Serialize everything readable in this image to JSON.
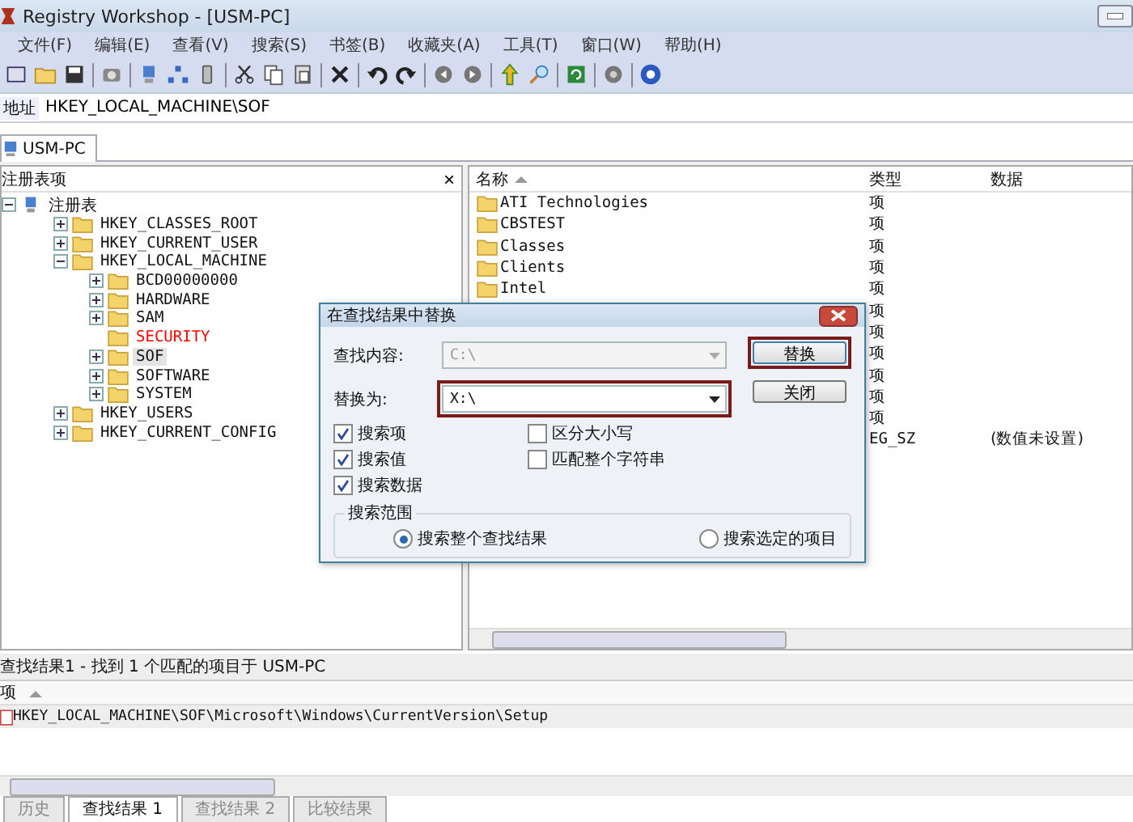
{
  "window": {
    "title": "Registry Workshop - [USM-PC]"
  },
  "menu": [
    "文件(F)",
    "编辑(E)",
    "查看(V)",
    "搜索(S)",
    "书签(B)",
    "收藏夹(A)",
    "工具(T)",
    "窗口(W)",
    "帮助(H)"
  ],
  "address": {
    "label": "地址",
    "value": "HKEY_LOCAL_MACHINE\\SOF"
  },
  "tabs": [
    {
      "label": "USM-PC",
      "selected": true
    }
  ],
  "tree": {
    "title": "注册表项",
    "close": "×",
    "root": {
      "label": "注册表",
      "expanded": true,
      "selected": false,
      "children": [
        {
          "label": "HKEY_CLASSES_ROOT",
          "expanded": false,
          "selected": false
        },
        {
          "label": "HKEY_CURRENT_USER",
          "expanded": false,
          "selected": false
        },
        {
          "label": "HKEY_LOCAL_MACHINE",
          "expanded": true,
          "selected": false,
          "children": [
            {
              "label": "BCD00000000",
              "expanded": false,
              "selected": false
            },
            {
              "label": "HARDWARE",
              "expanded": false,
              "selected": false
            },
            {
              "label": "SAM",
              "expanded": false,
              "selected": false
            },
            {
              "label": "SECURITY",
              "selected": false,
              "color": "#ff0000"
            },
            {
              "label": "SOF",
              "expanded": false,
              "selected": true
            },
            {
              "label": "SOFTWARE",
              "expanded": false,
              "selected": false
            },
            {
              "label": "SYSTEM",
              "expanded": false,
              "selected": false
            }
          ]
        },
        {
          "label": "HKEY_USERS",
          "expanded": false,
          "selected": false
        },
        {
          "label": "HKEY_CURRENT_CONFIG",
          "expanded": false,
          "selected": false
        }
      ]
    }
  },
  "list": {
    "columns": [
      "名称",
      "类型",
      "数据"
    ],
    "rows": [
      {
        "kind": "key",
        "name": "ATI Technologies",
        "type": "项"
      },
      {
        "kind": "key",
        "name": "CBSTEST",
        "type": "项"
      },
      {
        "kind": "key",
        "name": "Classes",
        "type": "项"
      },
      {
        "kind": "key",
        "name": "Clients",
        "type": "项"
      },
      {
        "kind": "key",
        "name": "Intel",
        "type": "项"
      },
      {
        "kind": "hidden",
        "type": "项"
      },
      {
        "kind": "hidden",
        "type": "项"
      },
      {
        "kind": "hidden",
        "type": "项"
      },
      {
        "kind": "hidden",
        "type": "项"
      },
      {
        "kind": "hidden",
        "type": "项"
      },
      {
        "kind": "hidden",
        "type": "项"
      },
      {
        "kind": "hidden",
        "type": "EG_SZ",
        "data": "(数值未设置)"
      }
    ]
  },
  "dialog": {
    "title": "在查找结果中替换",
    "fields": [
      {
        "label": "查找内容:",
        "value": "C:\\",
        "disabled": true,
        "highlighted": false
      },
      {
        "label": "替换为:",
        "value": "X:\\",
        "disabled": false,
        "highlighted": true
      }
    ],
    "buttons": [
      {
        "label": "替换",
        "highlighted": true
      },
      {
        "label": "关闭",
        "highlighted": false
      }
    ],
    "checkboxes": [
      {
        "label": "搜索项",
        "checked": true
      },
      {
        "label": "区分大小写",
        "checked": false
      },
      {
        "label": "搜索值",
        "checked": true
      },
      {
        "label": "匹配整个字符串",
        "checked": false
      },
      {
        "label": "搜索数据",
        "checked": true
      }
    ],
    "scope": {
      "title": "搜索范围",
      "options": [
        {
          "label": "搜索整个查找结果",
          "selected": true
        },
        {
          "label": "搜索选定的项目",
          "selected": false
        }
      ]
    }
  },
  "results": {
    "status": "查找结果1 - 找到 1 个匹配的项目于 USM-PC",
    "column": "项",
    "rows": [
      "HKEY_LOCAL_MACHINE\\SOF\\Microsoft\\Windows\\CurrentVersion\\Setup"
    ]
  },
  "bottom_tabs": [
    {
      "label": "历史",
      "selected": false
    },
    {
      "label": "查找结果 1",
      "selected": true
    },
    {
      "label": "查找结果 2",
      "selected": false
    },
    {
      "label": "比较结果",
      "selected": false
    }
  ]
}
